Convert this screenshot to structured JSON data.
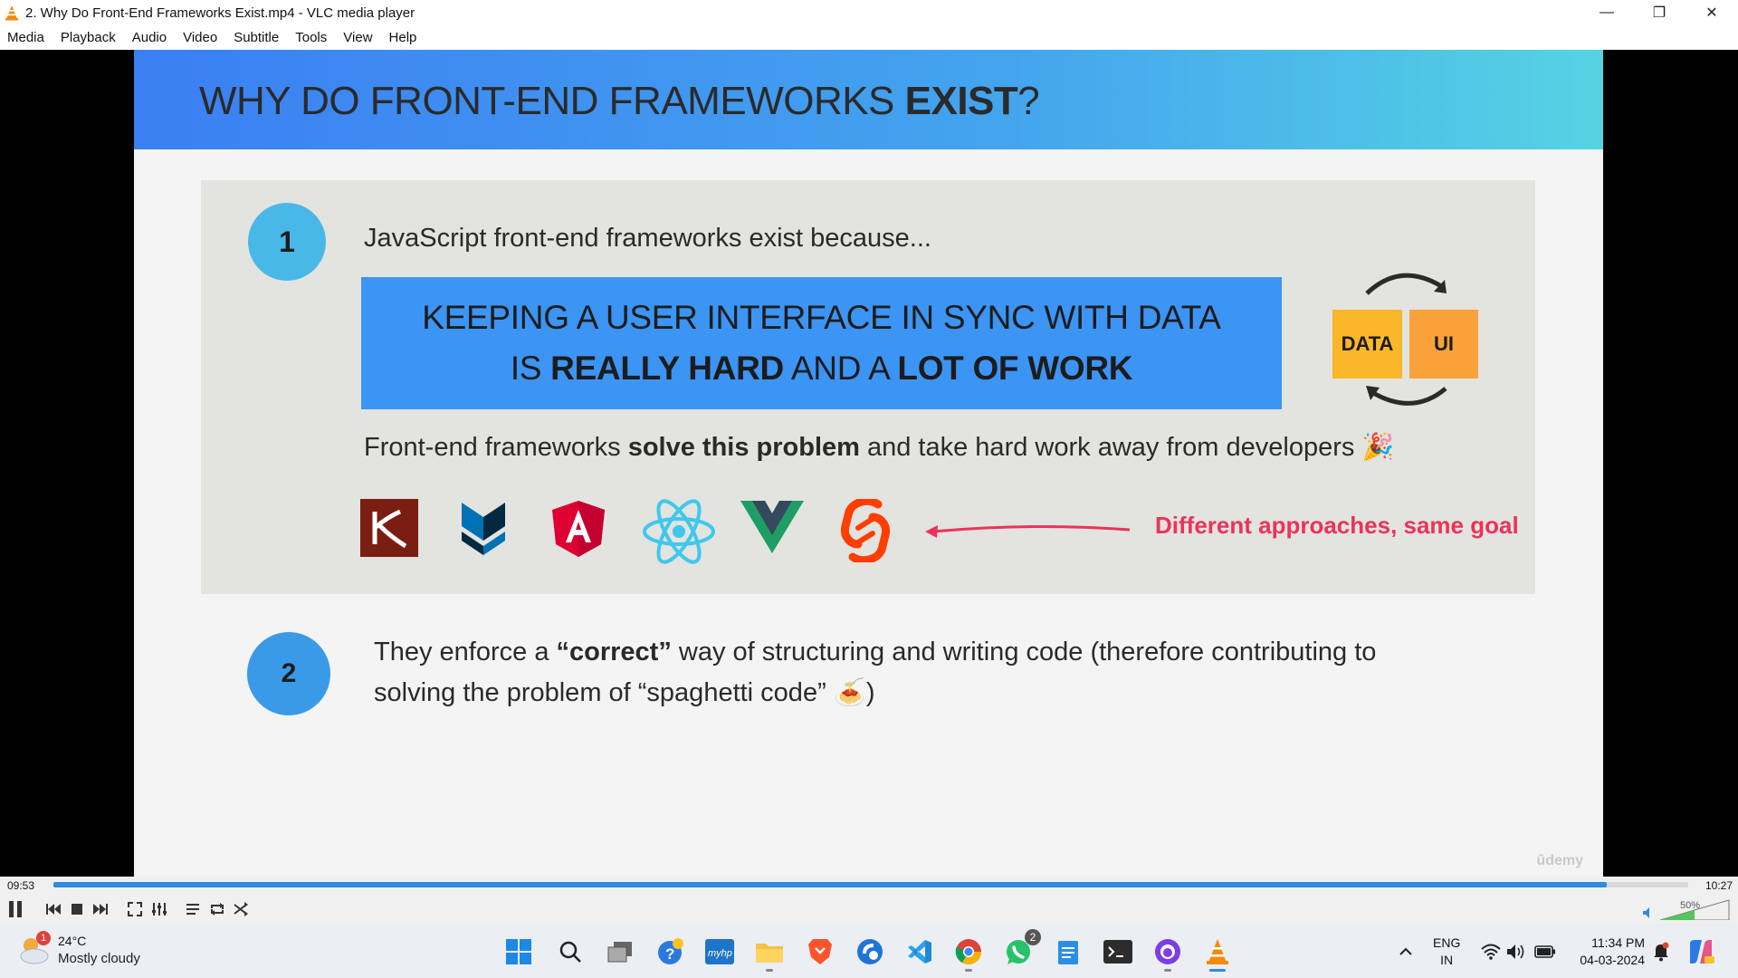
{
  "window": {
    "title": "2. Why Do Front-End Frameworks Exist.mp4 - VLC media player",
    "minimize": "—",
    "restore": "❐",
    "close": "✕"
  },
  "menu": [
    "Media",
    "Playback",
    "Audio",
    "Video",
    "Subtitle",
    "Tools",
    "View",
    "Help"
  ],
  "slide": {
    "title_prefix": "WHY DO FRONT-END FRAMEWORKS ",
    "title_bold": "EXIST",
    "title_suffix": "?",
    "point1_number": "1",
    "intro": "JavaScript front-end frameworks exist because...",
    "box_line1": "KEEPING A USER INTERFACE IN SYNC WITH DATA",
    "box_line2_a": "IS ",
    "box_line2_b": "REALLY HARD",
    "box_line2_c": " AND A ",
    "box_line2_d": "LOT OF WORK",
    "data_label": "DATA",
    "ui_label": "UI",
    "solve_a": "Front-end frameworks ",
    "solve_b": "solve this problem",
    "solve_c": " and take hard work away from developers 🎉",
    "diff_text": "Different approaches, same goal",
    "point2_number": "2",
    "enforce_a": "They enforce a ",
    "enforce_b": "“correct”",
    "enforce_c": " way of structuring and writing code (therefore contributing to solving the problem of “spaghetti code” 🍝)",
    "watermark": "ûdemy",
    "logo_names": [
      "knockout-logo",
      "backbone-logo",
      "angular-logo",
      "react-logo",
      "vue-logo",
      "svelte-logo"
    ]
  },
  "player": {
    "elapsed": "09:53",
    "total": "10:27",
    "progress_percent": 95,
    "volume_label": "50%",
    "volume_percent": 50
  },
  "taskbar": {
    "weather_temp": "24°C",
    "weather_cond": "Mostly cloudy",
    "weather_badge": "1",
    "whatsapp_badge": "2",
    "lang_top": "ENG",
    "lang_bottom": "IN",
    "time": "11:34 PM",
    "date": "04-03-2024"
  },
  "colors": {
    "header_gradient_start": "#3b7ff3",
    "header_gradient_end": "#55d3e3",
    "blue_box": "#3c94f4",
    "accent_red": "#ea3458",
    "seek_fill": "#2f8ae0"
  }
}
